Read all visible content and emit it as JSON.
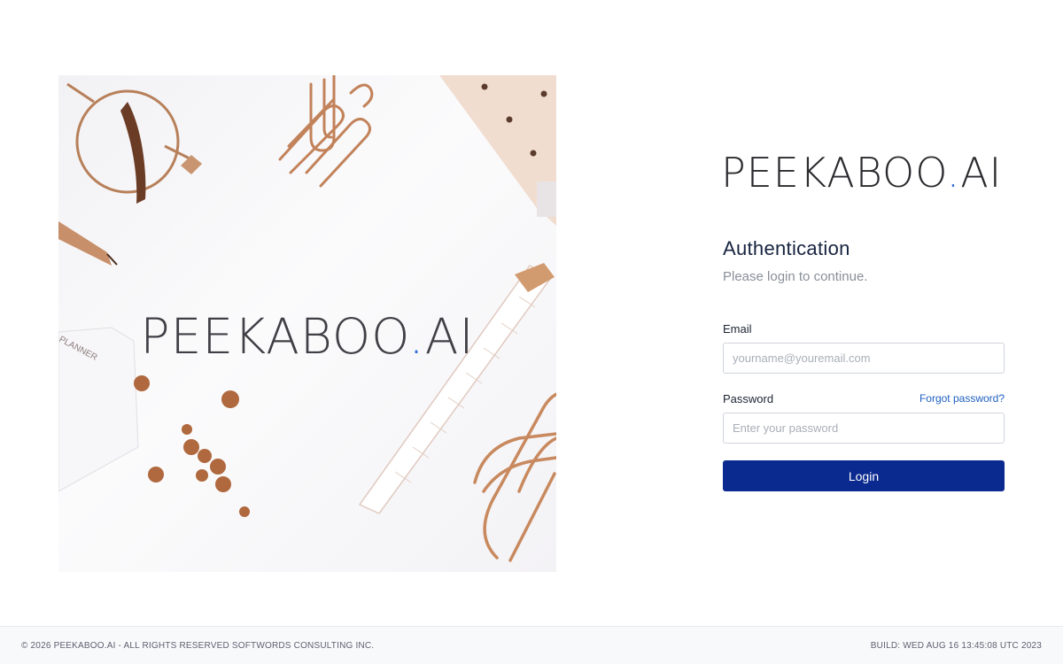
{
  "hero": {
    "logo_main": "PEEKABOO",
    "logo_dot": ".",
    "logo_tail": "AI",
    "planner_text": "PLANNER"
  },
  "brand": {
    "name_main": "PEEKABOO",
    "name_dot": ".",
    "name_tail": "AI",
    "dot_color": "#2f6fd6"
  },
  "auth": {
    "title": "Authentication",
    "subtitle": "Please login to continue.",
    "email_label": "Email",
    "email_placeholder": "yourname@youremail.com",
    "email_value": "",
    "password_label": "Password",
    "forgot_label": "Forgot password?",
    "password_placeholder": "Enter your password",
    "password_value": "",
    "login_label": "Login",
    "button_color": "#0a2a8f"
  },
  "footer": {
    "copyright": "© 2026 PEEKABOO.AI - ALL RIGHTS RESERVED SOFTWORDS CONSULTING INC.",
    "build": "BUILD: WED AUG 16 13:45:08 UTC 2023"
  }
}
